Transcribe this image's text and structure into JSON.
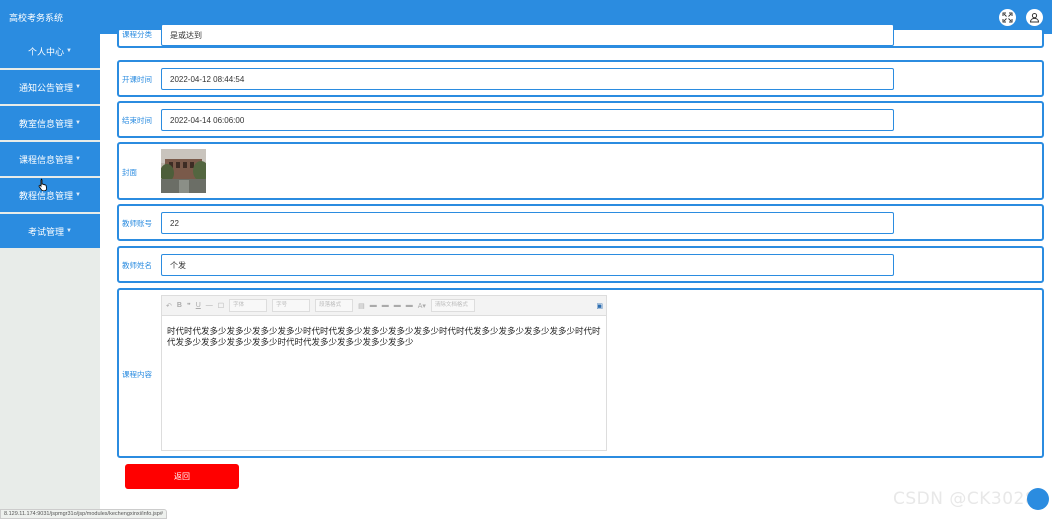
{
  "header": {
    "title": "高校考务系统",
    "icons": [
      "fullscreen-icon",
      "user-icon"
    ]
  },
  "sidebar": {
    "items": [
      {
        "label": "个人中心"
      },
      {
        "label": "通知公告管理"
      },
      {
        "label": "教室信息管理"
      },
      {
        "label": "课程信息管理"
      },
      {
        "label": "教程信息管理"
      },
      {
        "label": "考试管理"
      }
    ]
  },
  "form": {
    "category": {
      "label": "课程分类",
      "value": "是或达到"
    },
    "start_time": {
      "label": "开课时间",
      "value": "2022-04-12 08:44:54"
    },
    "end_time": {
      "label": "结束时间",
      "value": "2022-04-14 06:06:00"
    },
    "cover": {
      "label": "封面"
    },
    "teacher_account": {
      "label": "教师账号",
      "value": "22"
    },
    "teacher_name": {
      "label": "教师姓名",
      "value": "个发"
    },
    "content": {
      "label": "课程内容",
      "text": "时代时代发多少发多少发多少发多少时代时代发多少发多少发多少发多少时代时代发多少发多少发多少发多少时代时代发多少发多少发多少发多少时代时代发多少发多少发多少发多少",
      "toolbar": {
        "font_family": "字体",
        "font_size": "字号",
        "paragraph": "段落格式",
        "clear": "清除文档格式"
      }
    }
  },
  "actions": {
    "back_label": "返回"
  },
  "status_bar": {
    "url": "8.129.11.174:9031/jspmgr31o/jsp/modules/kechengxinxi/info.jsp#"
  },
  "watermark": "CSDN @CK3028",
  "colors": {
    "primary": "#2b8ce0",
    "danger": "#ff0000",
    "sidebar_bg": "#e8ece9"
  }
}
